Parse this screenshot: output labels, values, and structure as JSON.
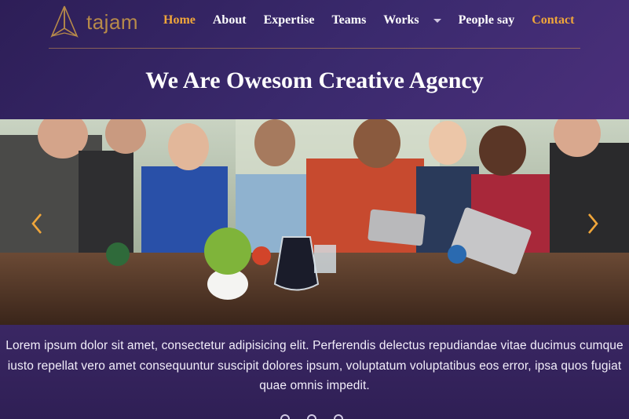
{
  "brand": {
    "name": "tajam"
  },
  "nav": {
    "items": [
      {
        "label": "Home"
      },
      {
        "label": "About"
      },
      {
        "label": "Expertise"
      },
      {
        "label": "Teams"
      },
      {
        "label": "Works"
      },
      {
        "label": "People say"
      },
      {
        "label": "Contact"
      }
    ]
  },
  "hero": {
    "title": "We Are Owesom Creative Agency",
    "caption": "Lorem ipsum dolor sit amet, consectetur adipisicing elit. Perferendis delectus repudiandae vitae ducimus cumque iusto repellat vero amet consequuntur suscipit dolores ipsum, voluptatum voluptatibus eos error, ipsa quos fugiat quae omnis impedit.",
    "slides": 3,
    "active_slide": 1
  },
  "colors": {
    "accent": "#f0a63a",
    "brand": "#b78a4a",
    "background": "#3b2a6e"
  },
  "icons": {
    "prev": "chevron-left-icon",
    "next": "chevron-right-icon",
    "dropdown": "caret-down-icon"
  }
}
